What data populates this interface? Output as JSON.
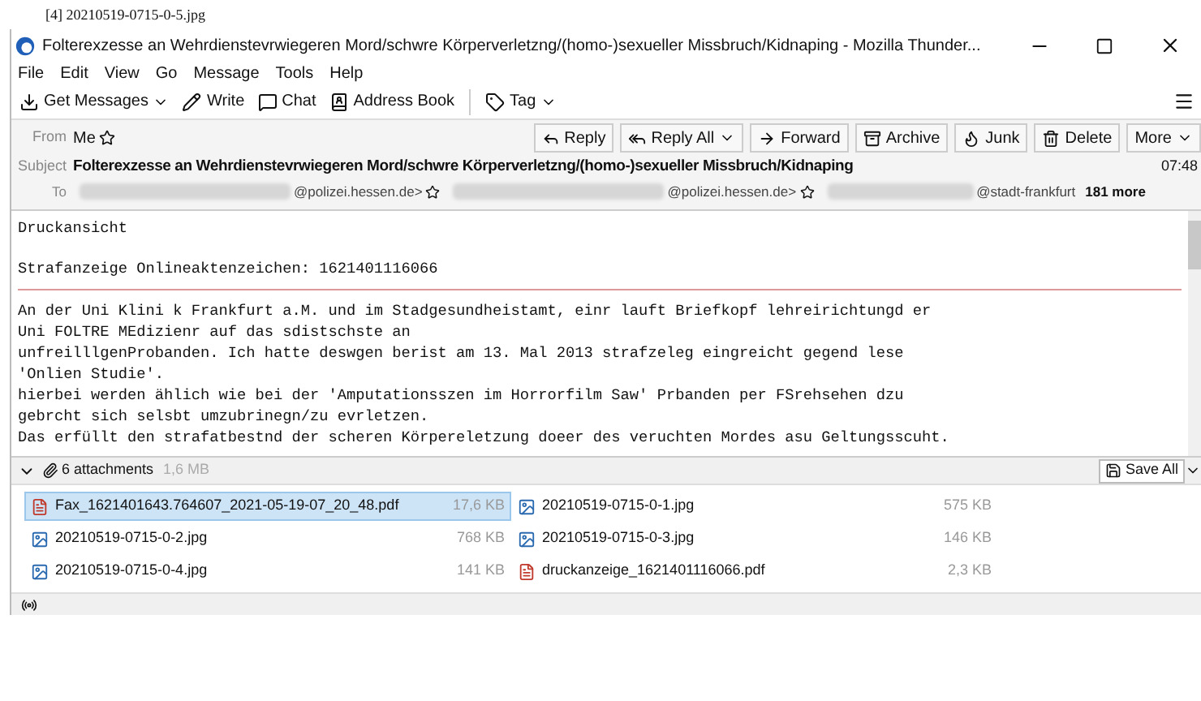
{
  "caption": "[4] 20210519-0715-0-5.jpg",
  "window": {
    "title": "Folterexzesse an Wehrdienstevrwiegeren Mord/schwre Körperverletzng/(homo-)sexueller Missbruch/Kidnaping - Mozilla Thunder..."
  },
  "menu": [
    "File",
    "Edit",
    "View",
    "Go",
    "Message",
    "Tools",
    "Help"
  ],
  "toolbar": [
    {
      "label": "Get Messages",
      "kind": "get",
      "dropdown": true
    },
    {
      "label": "Write",
      "kind": "write",
      "dropdown": false
    },
    {
      "label": "Chat",
      "kind": "chat",
      "dropdown": false
    },
    {
      "label": "Address Book",
      "kind": "book",
      "dropdown": false
    },
    {
      "label": "Tag",
      "kind": "tag",
      "dropdown": true
    }
  ],
  "header": {
    "from_label": "From",
    "from": "Me",
    "actions": [
      {
        "label": "Reply",
        "kind": "reply",
        "dropdown": false
      },
      {
        "label": "Reply All",
        "kind": "replyall",
        "dropdown": true
      },
      {
        "label": "Forward",
        "kind": "forward",
        "dropdown": false
      },
      {
        "label": "Archive",
        "kind": "archive",
        "dropdown": false
      },
      {
        "label": "Junk",
        "kind": "junk",
        "dropdown": false
      },
      {
        "label": "Delete",
        "kind": "delete",
        "dropdown": false
      },
      {
        "label": "More",
        "kind": "more",
        "dropdown": true
      }
    ],
    "subject_label": "Subject",
    "subject": "Folterexzesse an Wehrdienstevrwiegeren Mord/schwre Körperverletzng/(homo-)sexueller Missbruch/Kidnaping",
    "time": "07:48",
    "to_label": "To",
    "recipients": [
      "@polizei.hessen.de>",
      "@polizei.hessen.de>",
      "@stadt-frankfurt"
    ],
    "more": "181 more"
  },
  "body": {
    "lines_top": [
      "Druckansicht",
      "Strafanzeige Onlineaktenzeichen: 1621401116066"
    ],
    "paragraph": [
      "An der Uni Klini k Frankfurt a.M. und im Stadgesundheistamt, einr lauft Briefkopf lehreirichtungd er",
      "Uni FOLTRE MEdizienr auf das sdistschste an",
      "unfreilllgenProbanden. Ich hatte deswgen berist am 13. Mal 2013 strafzeleg eingreicht gegend lese",
      "'Onlien Studie'.",
      "hierbei werden ählich wie bei der 'Amputationsszen im Horrorfilm Saw' Prbanden per FSrehsehen dzu",
      "gebrcht sich selsbt umzubrinegn/zu evrletzen.",
      "Das erfüllt den strafatbestnd der scheren Körpereletzung doeer des veruchten Mordes asu Geltungsscuht."
    ]
  },
  "attachments_bar": {
    "count": "6 attachments",
    "size": "1,6 MB",
    "save": "Save All"
  },
  "attachments": [
    {
      "name": "Fax_1621401643.764607_2021-05-19-07_20_48.pdf",
      "size": "17,6 KB",
      "kind": "pdf",
      "selected": true
    },
    {
      "name": "20210519-0715-0-1.jpg",
      "size": "575 KB",
      "kind": "jpg",
      "selected": false
    },
    {
      "name": "20210519-0715-0-2.jpg",
      "size": "768 KB",
      "kind": "jpg",
      "selected": false
    },
    {
      "name": "20210519-0715-0-3.jpg",
      "size": "146 KB",
      "kind": "jpg",
      "selected": false
    },
    {
      "name": "20210519-0715-0-4.jpg",
      "size": "141 KB",
      "kind": "jpg",
      "selected": false
    },
    {
      "name": "druckanzeige_1621401116066.pdf",
      "size": "2,3 KB",
      "kind": "pdf",
      "selected": false
    }
  ]
}
